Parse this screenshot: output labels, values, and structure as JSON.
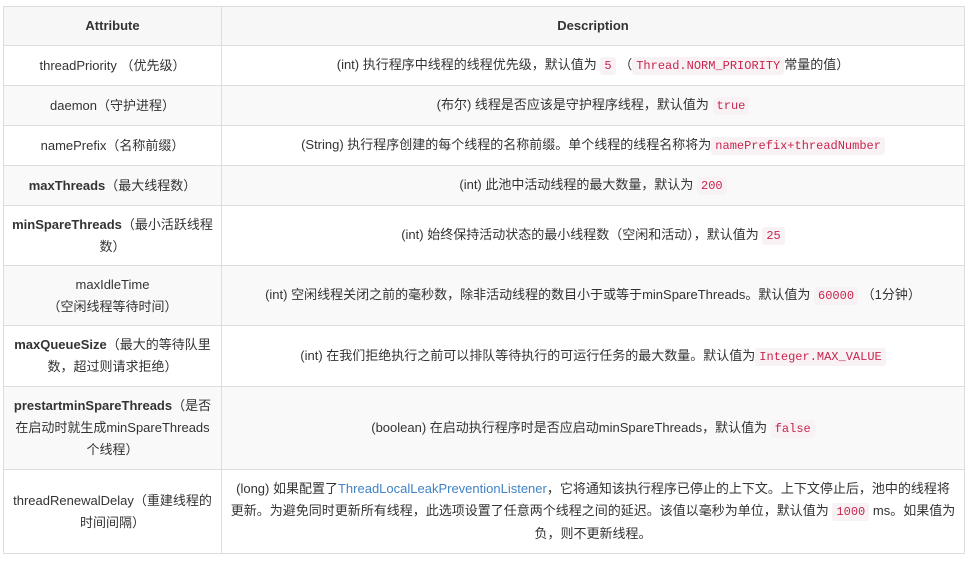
{
  "table": {
    "headers": [
      "Attribute",
      "Description"
    ],
    "rows": [
      {
        "attr_name": "threadPriority",
        "attr_note": "（优先级）",
        "desc_before": "(int) 执行程序中线程的线程优先级，默认值为",
        "desc_code": "5",
        "desc_mid": "（",
        "desc_code2": "Thread.NORM_PRIORITY",
        "desc_after": "常量的值）"
      },
      {
        "attr_name": "daemon",
        "attr_note": "（守护进程）",
        "desc_before": "(布尔) 线程是否应该是守护程序线程，默认值为",
        "desc_code": "true"
      },
      {
        "attr_name": "namePrefix",
        "attr_note": "（名称前缀）",
        "desc_before": "(String) 执行程序创建的每个线程的名称前缀。单个线程的线程名称将为",
        "desc_code": "namePrefix+threadNumber"
      },
      {
        "attr_name": "maxThreads",
        "attr_note": "（最大线程数）",
        "desc_before": "(int) 此池中活动线程的最大数量，默认为",
        "desc_code": "200"
      },
      {
        "attr_name": "minSpareThreads",
        "attr_note": "（最小活跃线程数）",
        "desc_before": "(int) 始终保持活动状态的最小线程数（空闲和活动），默认值为",
        "desc_code": "25"
      },
      {
        "attr_name": "maxIdleTime",
        "attr_note": "（空闲线程等待时间）",
        "desc_before": "(int) 空闲线程关闭之前的毫秒数，除非活动线程的数目小于或等于minSpareThreads。默认值为",
        "desc_code": "60000",
        "desc_after": "（1分钟）"
      },
      {
        "attr_name": "maxQueueSize",
        "attr_note": "（最大的等待队里数，超过则请求拒绝）",
        "desc_before": "(int) 在我们拒绝执行之前可以排队等待执行的可运行任务的最大数量。默认值为",
        "desc_code": "Integer.MAX_VALUE"
      },
      {
        "attr_name": "prestartminSpareThreads",
        "attr_note": "（是否在启动时就生成minSpareThreads个线程）",
        "desc_before": "(boolean) 在启动执行程序时是否应启动minSpareThreads，默认值为",
        "desc_code": "false"
      },
      {
        "attr_name": "threadRenewalDelay",
        "attr_note": "（重建线程的时间间隔）",
        "desc_before": "(long) 如果配置了",
        "desc_link": "ThreadLocalLeakPreventionListener",
        "desc_mid": "，它将通知该执行程序已停止的上下文。上下文停止后，池中的线程将更新。为避免同时更新所有线程，此选项设置了任意两个线程之间的延迟。该值以毫秒为单位，默认值为",
        "desc_code": "1000",
        "desc_after": "ms。如果值为负，则不更新线程。"
      }
    ]
  }
}
